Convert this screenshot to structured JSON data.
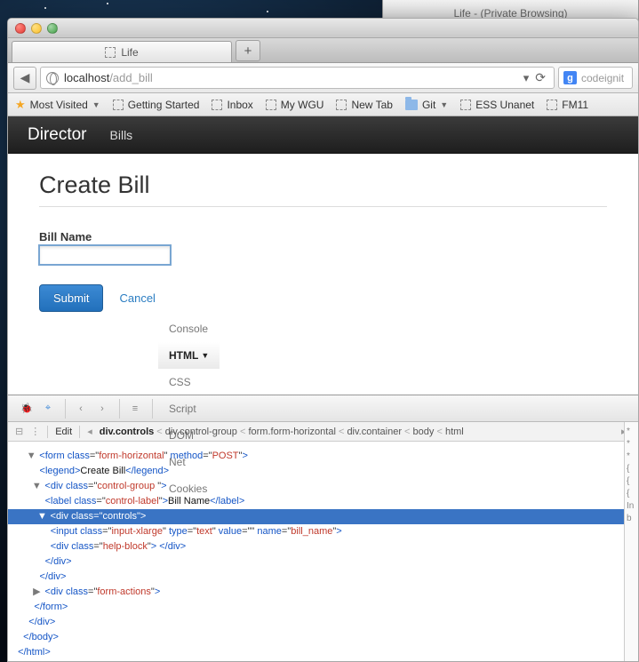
{
  "background_window": {
    "title": "Life - (Private Browsing)"
  },
  "window": {
    "tab": {
      "label": "Life"
    },
    "newtab_glyph": "+",
    "url": {
      "domain": "localhost",
      "path": "/add_bill"
    },
    "refresh_glyph": "⟳",
    "search": {
      "engine_glyph": "g",
      "placeholder": "codeignit"
    }
  },
  "bookmarks": {
    "items": [
      {
        "label": "Most Visited",
        "type": "star",
        "dropdown": true
      },
      {
        "label": "Getting Started",
        "type": "page"
      },
      {
        "label": "Inbox",
        "type": "page"
      },
      {
        "label": "My WGU",
        "type": "page"
      },
      {
        "label": "New Tab",
        "type": "page"
      },
      {
        "label": "Git",
        "type": "folder",
        "dropdown": true
      },
      {
        "label": "ESS Unanet",
        "type": "page"
      },
      {
        "label": "FM11",
        "type": "page"
      }
    ]
  },
  "app": {
    "brand": "Director",
    "nav": [
      {
        "label": "Bills"
      }
    ]
  },
  "page": {
    "heading": "Create Bill",
    "form": {
      "label": "Bill Name",
      "value": "",
      "submit": "Submit",
      "cancel": "Cancel"
    }
  },
  "devtools": {
    "tabs": [
      "Console",
      "HTML",
      "CSS",
      "Script",
      "DOM",
      "Net",
      "Cookies"
    ],
    "active_tab": 1,
    "edit_label": "Edit",
    "breadcrumbs": [
      "div.controls",
      "div.control-group",
      "form.form-horizontal",
      "div.container",
      "body",
      "html"
    ],
    "side_hints": [
      "*",
      "*",
      "*",
      "{ ",
      "{ ",
      "{ ",
      "",
      "In",
      "",
      "b"
    ],
    "code": [
      {
        "indent": 6,
        "toggle": "▼",
        "html": "<span class='tag'>&lt;form</span> <span class='attr'>class</span>=\"<span class='val'>form-horizontal</span>\" <span class='attr'>method</span>=\"<span class='val'>POST</span>\"<span class='tag'>&gt;</span>"
      },
      {
        "indent": 9,
        "html": "<span class='tag'>&lt;legend&gt;</span><span class='txt'>Create Bill</span><span class='tag'>&lt;/legend&gt;</span>"
      },
      {
        "indent": 8,
        "toggle": "▼",
        "html": "<span class='tag'>&lt;div</span> <span class='attr'>class</span>=\"<span class='val'>control-group </span>\"<span class='tag'>&gt;</span>"
      },
      {
        "indent": 11,
        "html": "<span class='tag'>&lt;label</span> <span class='attr'>class</span>=\"<span class='val'>control-label</span>\"<span class='tag'>&gt;</span><span class='txt'>Bill Name</span><span class='tag'>&lt;/label&gt;</span>"
      },
      {
        "indent": 10,
        "toggle": "▼",
        "selected": true,
        "html": "<span class='tag'>&lt;div</span> <span class='attr'>class</span>=\"<span class='val'>controls</span>\"<span class='tag'>&gt;</span>"
      },
      {
        "indent": 13,
        "html": "<span class='tag'>&lt;input</span> <span class='attr'>class</span>=\"<span class='val'>input-xlarge</span>\" <span class='attr'>type</span>=\"<span class='val'>text</span>\" <span class='attr'>value</span>=\"<span class='val'></span>\" <span class='attr'>name</span>=\"<span class='val'>bill_name</span>\"<span class='tag'>&gt;</span>"
      },
      {
        "indent": 13,
        "html": "<span class='tag'>&lt;div</span> <span class='attr'>class</span>=\"<span class='val'>help-block</span>\"<span class='tag'>&gt;</span> <span class='tag'>&lt;/div&gt;</span>"
      },
      {
        "indent": 11,
        "html": "<span class='tag'>&lt;/div&gt;</span>"
      },
      {
        "indent": 9,
        "html": "<span class='tag'>&lt;/div&gt;</span>"
      },
      {
        "indent": 8,
        "toggle": "▶",
        "html": "<span class='tag'>&lt;div</span> <span class='attr'>class</span>=\"<span class='val'>form-actions</span>\"<span class='tag'>&gt;</span>"
      },
      {
        "indent": 7,
        "html": "<span class='tag'>&lt;/form&gt;</span>"
      },
      {
        "indent": 5,
        "html": "<span class='tag'>&lt;/div&gt;</span>"
      },
      {
        "indent": 3,
        "html": "<span class='tag'>&lt;/body&gt;</span>"
      },
      {
        "indent": 1,
        "html": "<span class='tag'>&lt;/html&gt;</span>"
      }
    ]
  }
}
